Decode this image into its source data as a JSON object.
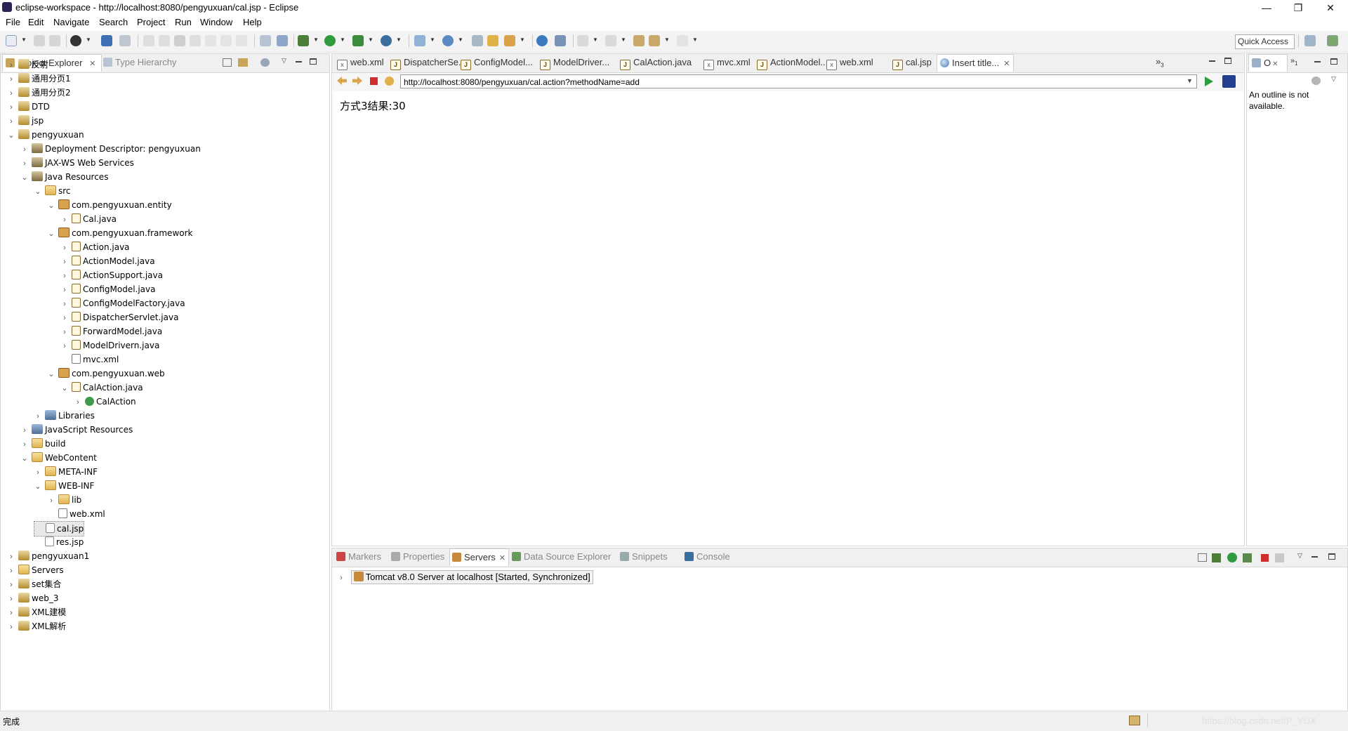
{
  "window": {
    "title": "eclipse-workspace - http://localhost:8080/pengyuxuan/cal.jsp - Eclipse",
    "minimize": "—",
    "restore": "❐",
    "close": "✕"
  },
  "menu": [
    "File",
    "Edit",
    "Navigate",
    "Search",
    "Project",
    "Run",
    "Window",
    "Help"
  ],
  "toolbar": {
    "quick_access": "Quick Access"
  },
  "left_panel": {
    "tabs": [
      {
        "label": "Project Explorer",
        "close": "✕"
      },
      {
        "label": "Type Hierarchy"
      }
    ],
    "tree": [
      {
        "label": "反射",
        "depth": 0,
        "twisty": ">",
        "icon": "project"
      },
      {
        "label": "通用分页1",
        "depth": 0,
        "twisty": ">",
        "icon": "project"
      },
      {
        "label": "通用分页2",
        "depth": 0,
        "twisty": ">",
        "icon": "project"
      },
      {
        "label": "DTD",
        "depth": 0,
        "twisty": ">",
        "icon": "project"
      },
      {
        "label": "jsp",
        "depth": 0,
        "twisty": ">",
        "icon": "project"
      },
      {
        "label": "pengyuxuan",
        "depth": 0,
        "twisty": "v",
        "icon": "project"
      },
      {
        "label": "Deployment Descriptor: pengyuxuan",
        "depth": 1,
        "twisty": ">",
        "icon": "dd"
      },
      {
        "label": "JAX-WS Web Services",
        "depth": 1,
        "twisty": ">",
        "icon": "dd"
      },
      {
        "label": "Java Resources",
        "depth": 1,
        "twisty": "v",
        "icon": "dd"
      },
      {
        "label": "src",
        "depth": 2,
        "twisty": "v",
        "icon": "folder"
      },
      {
        "label": "com.pengyuxuan.entity",
        "depth": 3,
        "twisty": "v",
        "icon": "package"
      },
      {
        "label": "Cal.java",
        "depth": 4,
        "twisty": ">",
        "icon": "java"
      },
      {
        "label": "com.pengyuxuan.framework",
        "depth": 3,
        "twisty": "v",
        "icon": "package"
      },
      {
        "label": "Action.java",
        "depth": 4,
        "twisty": ">",
        "icon": "java"
      },
      {
        "label": "ActionModel.java",
        "depth": 4,
        "twisty": ">",
        "icon": "java"
      },
      {
        "label": "ActionSupport.java",
        "depth": 4,
        "twisty": ">",
        "icon": "java"
      },
      {
        "label": "ConfigModel.java",
        "depth": 4,
        "twisty": ">",
        "icon": "java"
      },
      {
        "label": "ConfigModelFactory.java",
        "depth": 4,
        "twisty": ">",
        "icon": "java"
      },
      {
        "label": "DispatcherServlet.java",
        "depth": 4,
        "twisty": ">",
        "icon": "java"
      },
      {
        "label": "ForwardModel.java",
        "depth": 4,
        "twisty": ">",
        "icon": "java"
      },
      {
        "label": "ModelDrivern.java",
        "depth": 4,
        "twisty": ">",
        "icon": "java"
      },
      {
        "label": "mvc.xml",
        "depth": 4,
        "twisty": "",
        "icon": "xml"
      },
      {
        "label": "com.pengyuxuan.web",
        "depth": 3,
        "twisty": "v",
        "icon": "package"
      },
      {
        "label": "CalAction.java",
        "depth": 4,
        "twisty": "v",
        "icon": "java"
      },
      {
        "label": "CalAction",
        "depth": 5,
        "twisty": ">",
        "icon": "class"
      },
      {
        "label": "Libraries",
        "depth": 2,
        "twisty": ">",
        "icon": "lib"
      },
      {
        "label": "JavaScript Resources",
        "depth": 1,
        "twisty": ">",
        "icon": "lib"
      },
      {
        "label": "build",
        "depth": 1,
        "twisty": ">",
        "icon": "folder"
      },
      {
        "label": "WebContent",
        "depth": 1,
        "twisty": "v",
        "icon": "folder"
      },
      {
        "label": "META-INF",
        "depth": 2,
        "twisty": ">",
        "icon": "folder"
      },
      {
        "label": "WEB-INF",
        "depth": 2,
        "twisty": "v",
        "icon": "folder"
      },
      {
        "label": "lib",
        "depth": 3,
        "twisty": ">",
        "icon": "folder"
      },
      {
        "label": "web.xml",
        "depth": 3,
        "twisty": "",
        "icon": "xml"
      },
      {
        "label": "cal.jsp",
        "depth": 2,
        "twisty": "",
        "icon": "jsp",
        "selected": true
      },
      {
        "label": "res.jsp",
        "depth": 2,
        "twisty": "",
        "icon": "jsp"
      },
      {
        "label": "pengyuxuan1",
        "depth": 0,
        "twisty": ">",
        "icon": "project"
      },
      {
        "label": "Servers",
        "depth": 0,
        "twisty": ">",
        "icon": "folder"
      },
      {
        "label": "set集合",
        "depth": 0,
        "twisty": ">",
        "icon": "project"
      },
      {
        "label": "web_3",
        "depth": 0,
        "twisty": ">",
        "icon": "project"
      },
      {
        "label": "XML建模",
        "depth": 0,
        "twisty": ">",
        "icon": "project"
      },
      {
        "label": "XML解析",
        "depth": 0,
        "twisty": ">",
        "icon": "project"
      }
    ]
  },
  "editor": {
    "tabs": [
      {
        "label": "web.xml",
        "icon": "xml"
      },
      {
        "label": "DispatcherSe...",
        "icon": "java"
      },
      {
        "label": "ConfigModel...",
        "icon": "java"
      },
      {
        "label": "ModelDriver...",
        "icon": "java"
      },
      {
        "label": "CalAction.java",
        "icon": "java"
      },
      {
        "label": "mvc.xml",
        "icon": "xml"
      },
      {
        "label": "ActionModel....",
        "icon": "java"
      },
      {
        "label": "web.xml",
        "icon": "xml"
      },
      {
        "label": "cal.jsp",
        "icon": "java"
      },
      {
        "label": "Insert title...",
        "icon": "globe",
        "active": true
      }
    ],
    "overflow_label": "»",
    "overflow_count": "3",
    "url": "http://localhost:8080/pengyuxuan/cal.action?methodName=add",
    "page_text": "方式3结果:30"
  },
  "outline": {
    "tab_label": "O",
    "tab_count": "1",
    "message": "An outline is not available."
  },
  "bottom_panel": {
    "tabs": [
      {
        "label": "Markers"
      },
      {
        "label": "Properties"
      },
      {
        "label": "Servers",
        "active": true
      },
      {
        "label": "Data Source Explorer"
      },
      {
        "label": "Snippets"
      },
      {
        "label": "Console"
      }
    ],
    "servers": [
      {
        "label": "Tomcat v8.0 Server at localhost  [Started, Synchronized]"
      }
    ]
  },
  "status": {
    "text": "完成",
    "watermark": "https://blog.csdn.net/P_YUX"
  }
}
